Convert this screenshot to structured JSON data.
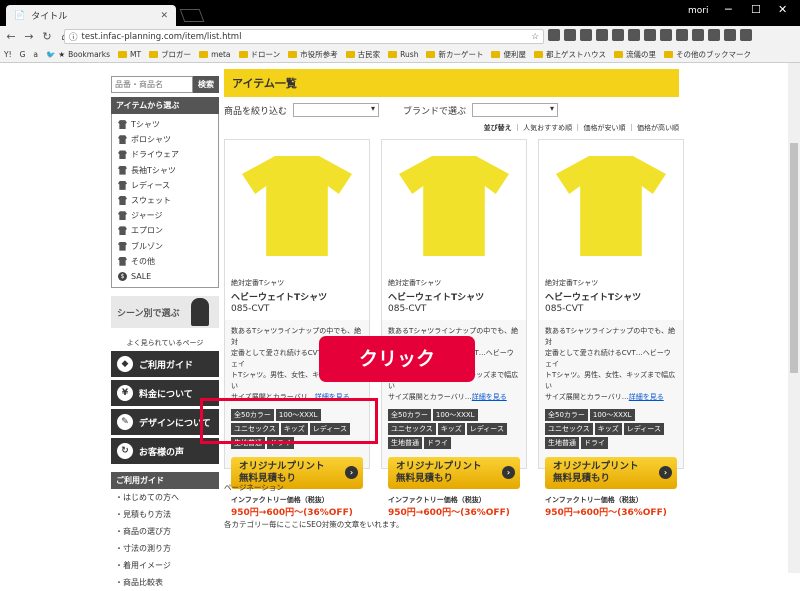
{
  "browser": {
    "tab_title": "タイトル",
    "user": "mori",
    "url": "test.infac-planning.com/item/list.html"
  },
  "bookmarks": [
    "Y!",
    "G",
    "a",
    "Bookmarks",
    "MT",
    "ブロガー",
    "meta",
    "ドローン",
    "市役所参考",
    "古民家",
    "Rush",
    "新カーゲート",
    "便利屋",
    "都上ゲストハウス",
    "流儀の里",
    "その他のブックマーク"
  ],
  "sidebar": {
    "search_placeholder": "品番・商品名",
    "search_button": "検索",
    "categories_title": "アイテムから選ぶ",
    "categories": [
      "Tシャツ",
      "ポロシャツ",
      "ドライウェア",
      "長袖Tシャツ",
      "レディース",
      "スウェット",
      "ジャージ",
      "エプロン",
      "ブルゾン",
      "その他",
      "SALE"
    ],
    "scene": "シーン別で選ぶ",
    "popular": "よく見られているページ",
    "big_buttons": [
      {
        "label": "ご利用ガイド",
        "icon": "beginner-icon"
      },
      {
        "label": "料金について",
        "icon": "yen-icon"
      },
      {
        "label": "デザインについて",
        "icon": "pen-icon"
      },
      {
        "label": "お客様の声",
        "icon": "voice-icon"
      }
    ],
    "guide_title": "ご利用ガイド",
    "guide_items": [
      "はじめての方へ",
      "見積もり方法",
      "商品の選び方",
      "寸法の測り方",
      "着用イメージ",
      "商品比較表"
    ]
  },
  "main": {
    "title": "アイテム一覧",
    "filter_label": "商品を絞り込む",
    "brand_label": "ブランドで選ぶ",
    "sort_label": "並び替え",
    "sort_options": [
      "人気おすすめ順",
      "価格が安い順",
      "価格が高い順"
    ],
    "pagination": "ページネーション",
    "seo": "各カテゴリー毎にここにSEO対策の文章をいれます。"
  },
  "products": [
    {
      "label": "絶対定番Tシャツ",
      "name": "ヘビーウェイトTシャツ",
      "code": "085-CVT",
      "desc1": "数あるTシャツラインナップの中でも、絶対",
      "desc2": "定番として愛され続けるCVT…ヘビーウェイ",
      "desc3": "トTシャツ。男性、女性、キッズまで幅広い",
      "desc4": "サイズ展開とカラーバリ…",
      "more": "詳細を見る",
      "tags": [
        "全50カラー",
        "100〜XXXL",
        "ユニセックス",
        "キッズ",
        "レディース",
        "生地普通",
        "ドライ"
      ],
      "quote1": "オリジナルプリント",
      "quote2": "無料見積もり",
      "price_label": "インファクトリー価格（税抜）",
      "price": "950円→600円〜(36%OFF)"
    },
    {
      "label": "絶対定番Tシャツ",
      "name": "ヘビーウェイトTシャツ",
      "code": "085-CVT",
      "desc1": "数あるTシャツラインナップの中でも、絶対",
      "desc2": "定番として愛され続けるCVT…ヘビーウェイ",
      "desc3": "トTシャツ。男性、女性、キッズまで幅広い",
      "desc4": "サイズ展開とカラーバリ…",
      "more": "詳細を見る",
      "tags": [
        "全50カラー",
        "100〜XXXL",
        "ユニセックス",
        "キッズ",
        "レディース",
        "生地普通",
        "ドライ"
      ],
      "quote1": "オリジナルプリント",
      "quote2": "無料見積もり",
      "price_label": "インファクトリー価格（税抜）",
      "price": "950円→600円〜(36%OFF)"
    },
    {
      "label": "絶対定番Tシャツ",
      "name": "ヘビーウェイトTシャツ",
      "code": "085-CVT",
      "desc1": "数あるTシャツラインナップの中でも、絶対",
      "desc2": "定番として愛され続けるCVT…ヘビーウェイ",
      "desc3": "トTシャツ。男性、女性、キッズまで幅広い",
      "desc4": "サイズ展開とカラーバリ…",
      "more": "詳細を見る",
      "tags": [
        "全50カラー",
        "100〜XXXL",
        "ユニセックス",
        "キッズ",
        "レディース",
        "生地普通",
        "ドライ"
      ],
      "quote1": "オリジナルプリント",
      "quote2": "無料見積もり",
      "price_label": "インファクトリー価格（税抜）",
      "price": "950円→600円〜(36%OFF)"
    }
  ],
  "overlay": {
    "click": "クリック"
  },
  "colors": {
    "accent": "#f5d21a",
    "sale": "#e8380d",
    "annotation": "#e60039"
  }
}
